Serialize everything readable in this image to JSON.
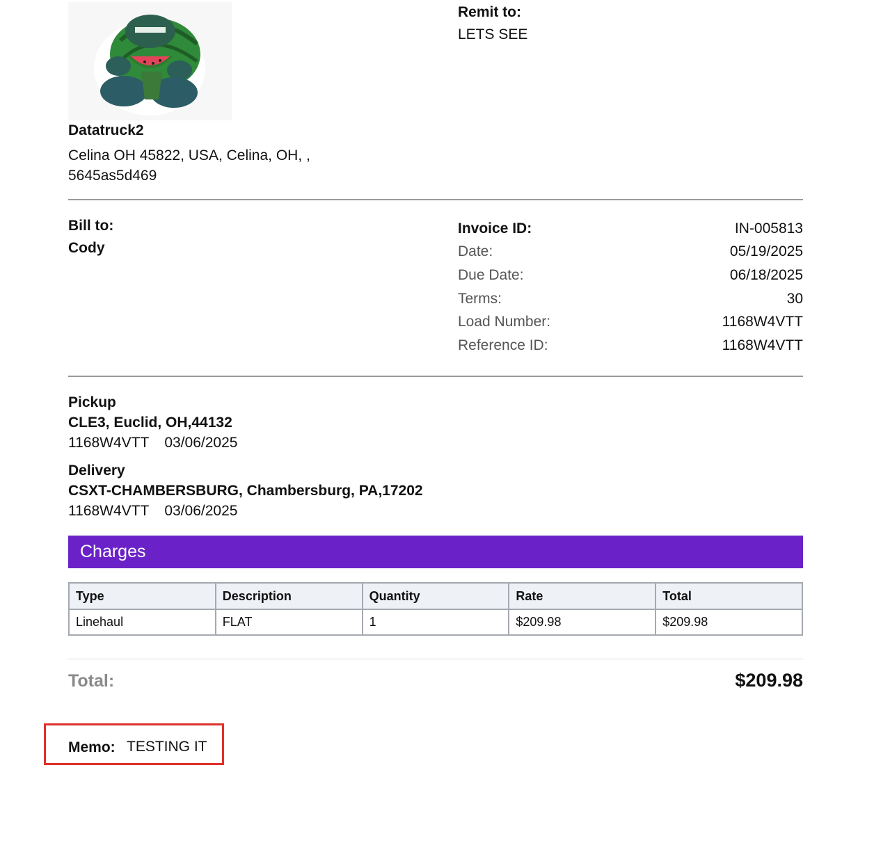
{
  "company": {
    "logo_icon": "company-logo-creature-icon",
    "name": "Datatruck2",
    "address_line1": "Celina OH 45822, USA, Celina, OH, ,",
    "address_line2": "5645as5d469"
  },
  "remit": {
    "label": "Remit to:",
    "value": "LETS SEE"
  },
  "bill_to": {
    "label": "Bill to:",
    "name": "Cody"
  },
  "invoice_meta": [
    {
      "label": "Invoice ID:",
      "value": "IN-005813"
    },
    {
      "label": "Date:",
      "value": "05/19/2025"
    },
    {
      "label": "Due Date:",
      "value": "06/18/2025"
    },
    {
      "label": "Terms:",
      "value": "30"
    },
    {
      "label": "Load Number:",
      "value": "1168W4VTT"
    },
    {
      "label": "Reference ID:",
      "value": "1168W4VTT"
    }
  ],
  "pickup": {
    "title": "Pickup",
    "location": "CLE3, Euclid, OH,44132",
    "ref": "1168W4VTT",
    "date": "03/06/2025"
  },
  "delivery": {
    "title": "Delivery",
    "location": "CSXT-CHAMBERSBURG, Chambersburg, PA,17202",
    "ref": "1168W4VTT",
    "date": "03/06/2025"
  },
  "charges": {
    "title": "Charges",
    "headers": [
      "Type",
      "Description",
      "Quantity",
      "Rate",
      "Total"
    ],
    "rows": [
      [
        "Linehaul",
        "FLAT",
        "1",
        "$209.98",
        "$209.98"
      ]
    ]
  },
  "total": {
    "label": "Total:",
    "value": "$209.98"
  },
  "memo": {
    "label": "Memo:",
    "value": "TESTING IT"
  },
  "colors": {
    "charges_bar": "#6a22c8",
    "memo_highlight": "#e0302a",
    "rule": "#9a9a9a"
  }
}
